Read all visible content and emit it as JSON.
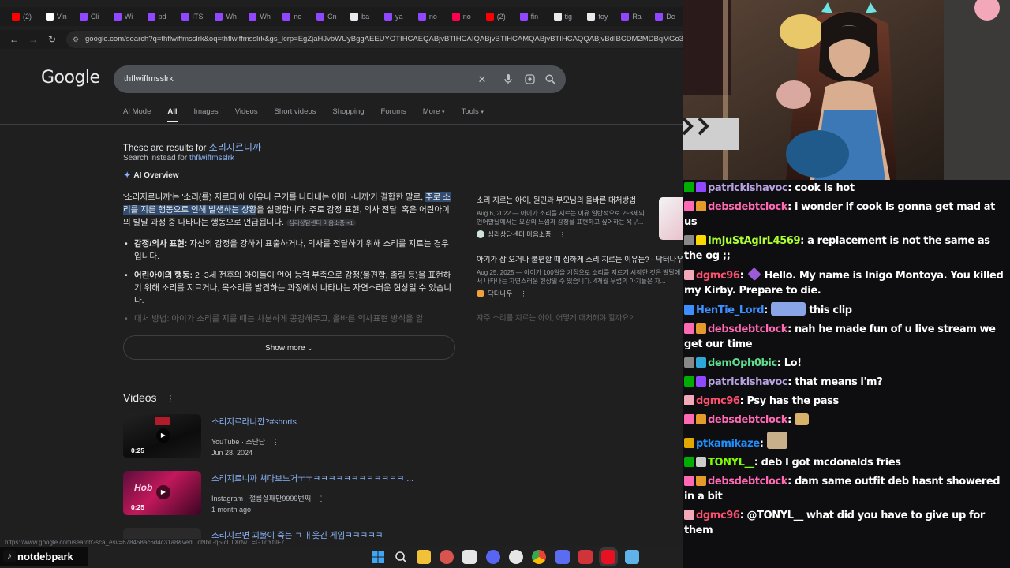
{
  "browser": {
    "tabs": [
      {
        "label": "(2)",
        "color": "#ff0000"
      },
      {
        "label": "Vin",
        "color": "#ffffff"
      },
      {
        "label": "Cli",
        "color": "#9146ff"
      },
      {
        "label": "Wi",
        "color": "#9146ff"
      },
      {
        "label": "pd",
        "color": "#9146ff"
      },
      {
        "label": "ITS",
        "color": "#9146ff"
      },
      {
        "label": "Wh",
        "color": "#9146ff"
      },
      {
        "label": "Wh",
        "color": "#9146ff"
      },
      {
        "label": "no",
        "color": "#9146ff"
      },
      {
        "label": "Cn",
        "color": "#9146ff"
      },
      {
        "label": "ba",
        "color": "#e8eaed"
      },
      {
        "label": "ya",
        "color": "#9146ff"
      },
      {
        "label": "no",
        "color": "#9146ff"
      },
      {
        "label": "no",
        "color": "#ff0050"
      },
      {
        "label": "(2)",
        "color": "#ff0000"
      },
      {
        "label": "fin",
        "color": "#9146ff"
      },
      {
        "label": "tig",
        "color": "#e8eaed"
      },
      {
        "label": "toy",
        "color": "#e8eaed"
      },
      {
        "label": "Ra",
        "color": "#9146ff"
      },
      {
        "label": "De",
        "color": "#9146ff"
      }
    ],
    "url": "google.com/search?q=thflwiffmsslrk&oq=thflwiffmsslrk&gs_lcrp=EgZjaHJvbWUyBggAEEUYOTIHCAEQABjvBTIHCAIQABjvBTIHCAMQABjvBTIHCAQQABjvBdIBCDM2MDBqMGo3qAIIsAI8"
  },
  "google": {
    "logo": "Google",
    "query": "thflwiffmsslrk",
    "nav_tabs": [
      "AI Mode",
      "All",
      "Images",
      "Videos",
      "Short videos",
      "Shopping",
      "Forums",
      "More",
      "Tools"
    ],
    "results_for_prefix": "These are results for",
    "results_for_term": "소리지르니까",
    "search_instead_prefix": "Search instead for",
    "search_instead_term": "thflwiffmsslrk",
    "ai_overview_label": "AI Overview",
    "ai_para_1": "'소리지르니까'는 '소리(를) 지르다'에 이유나 근거를 나타내는 어미 '-니까'가 결합한 말로,",
    "ai_para_hl": "주로 소리를 지른 행동으로 인해 발생하는 상황",
    "ai_para_2": "을 설명합니다. 주로 감정 표현, 의사 전달, 혹은 어린아이의 발달 과정 중 나타나는 행동으로 언급됩니다.",
    "ai_para_source": "심리상담센터 마음소풍 +1",
    "bullet_1_label": "감정/의사 표현:",
    "bullet_1_text": " 자신의 감정을 강하게 표출하거나, 의사를 전달하기 위해 소리를 지르는 경우입니다.",
    "bullet_2_label": "어린아이의 행동:",
    "bullet_2_text": " 2~3세 전후의 아이들이 언어 능력 부족으로 감정(불편함, 졸림 등)을 표현하기 위해 소리를 지르거나, 목소리를 발견하는 과정에서 나타나는 자연스러운 현상일 수 있습니다.",
    "bullet_3_faded": "대처 방법: 아이가 소리를 지를 때는 차분하게 공감해주고, 올바른 의사표현 방식을 알",
    "show_more": "Show more",
    "right_cards": [
      {
        "title": "소리 지르는 아이, 원인과 부모님의 올바른 대처방법",
        "snippet": "Aug 6, 2022 — 아이가 소리를 지르는 이유 일반적으로 2~3세의 언어발달에서는 요감의 느낌과 감정을 표현하고 싶어하는 욕구...",
        "source": "심리상담센터 마음소풍"
      },
      {
        "title": "아기가 잠 오거나 불편할 때 심하게 소리 지르는 이유는? - 닥터나우",
        "snippet": "Aug 25, 2025 — 아이가 100일을 기점으로 소리를 지르기 시작한 것은 발달에서 나타나는 자연스러운 현상일 수 있습니다. 4개월 무렵의 아기들은 자...",
        "source": "닥터나우"
      },
      {
        "title": "자주 소리를 지르는 아이, 어떻게 대처해야 할까요?",
        "snippet": "",
        "source": ""
      }
    ],
    "videos_header": "Videos",
    "videos": [
      {
        "title": "소리지르라니깐?#shorts",
        "source": "YouTube · 조단단",
        "date": "Jun 28, 2024",
        "duration": "0:25"
      },
      {
        "title": "소리지르니까 쳐다보느거ㅜㅜㅋㅋㅋㅋㅋㅋㅋㅋㅋㅋㅋㅋ ...",
        "source": "Instagram · 절름실패만9999번째",
        "date": "1 month ago",
        "duration": "0:25"
      },
      {
        "title": "소리지르면 괴물이 죽는 ㄱ ㅐ웃긴 게임ㅋㅋㅋㅋㅋ",
        "source": "",
        "date": "",
        "duration": ""
      }
    ],
    "status_url": "https://www.google.com/search?sca_esv=678458ac6d4c31a8&ved...dNbL-q5-c0TXrtw...=GTdYtIlF7"
  },
  "watermark": "notdebpark",
  "chat": [
    {
      "user": "patrickishavoc",
      "color": "#b9a3e3",
      "badges": [
        "#00ad03",
        "#9146ff"
      ],
      "text": "cook is hot"
    },
    {
      "user": "debsdebtclock",
      "color": "#ff69b4",
      "badges": [
        "#ff69b4",
        "#e59b2b"
      ],
      "text": "i wonder if cook is gonna get mad at us"
    },
    {
      "user": "ImJuStAgIrL4569",
      "color": "#adff2f",
      "badges": [
        "#888888",
        "#ffd700"
      ],
      "text": "a replacement is not the same as the og ;;"
    },
    {
      "user": "dgmc96",
      "color": "#ff4f6f",
      "badges": [
        "#f4a9b8"
      ],
      "text": "Hello. My name is Inigo Montoya. You killed my Kirby. Prepare to die.",
      "emote": "#9b5bd6"
    },
    {
      "user": "HenTie_Lord",
      "color": "#3d8fff",
      "badges": [
        "#3d8fff"
      ],
      "text": "this clip",
      "emote": "#8aa4e8"
    },
    {
      "user": "debsdebtclock",
      "color": "#ff69b4",
      "badges": [
        "#ff69b4",
        "#e59b2b"
      ],
      "text": "nah he made fun of u live stream we get our time"
    },
    {
      "user": "demOph0bic",
      "color": "#5fdc8e",
      "badges": [
        "#888888",
        "#2ea8d8"
      ],
      "text": "Lo!"
    },
    {
      "user": "patrickishavoc",
      "color": "#b9a3e3",
      "badges": [
        "#00ad03",
        "#9146ff"
      ],
      "text": "that means i'm?"
    },
    {
      "user": "dgmc96",
      "color": "#ff4f6f",
      "badges": [
        "#f4a9b8"
      ],
      "text": "Psy has the pass"
    },
    {
      "user": "debsdebtclock",
      "color": "#ff69b4",
      "badges": [
        "#ff69b4",
        "#e59b2b"
      ],
      "text": "",
      "emote": "#d8b26a"
    },
    {
      "user": "ptkamikaze",
      "color": "#1e90ff",
      "badges": [
        "#e0a800"
      ],
      "text": "",
      "emote": "#c8b08a"
    },
    {
      "user": "TONYL__",
      "color": "#7fff00",
      "badges": [
        "#00ad03",
        "#cccccc"
      ],
      "text": "deb I got mcdonalds fries"
    },
    {
      "user": "debsdebtclock",
      "color": "#ff69b4",
      "badges": [
        "#ff69b4",
        "#e59b2b"
      ],
      "text": "dam same outfit deb hasnt showered in a bit"
    },
    {
      "user": "dgmc96",
      "color": "#ff4f6f",
      "badges": [
        "#f4a9b8"
      ],
      "text": "@TONYL__ what did you have to give up for them"
    }
  ]
}
